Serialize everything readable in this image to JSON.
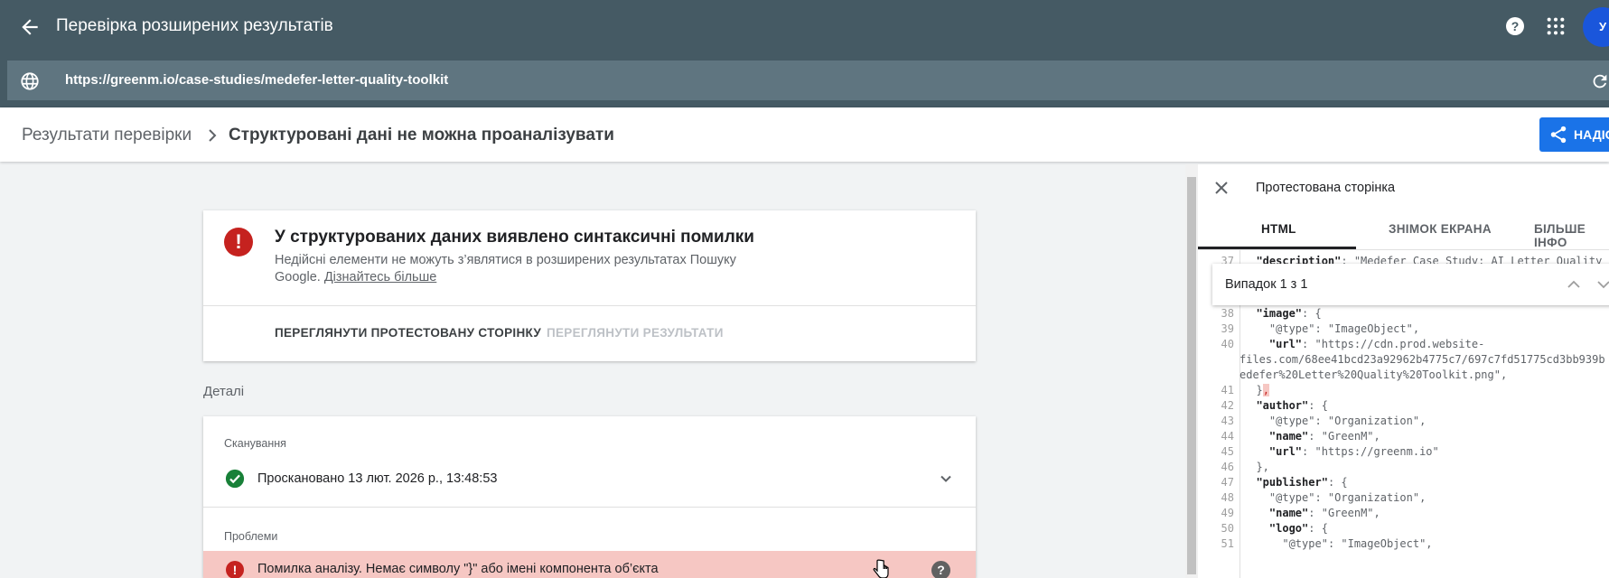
{
  "header": {
    "title": "Перевірка розширених результатів",
    "avatar_letter": "У"
  },
  "urlbar": {
    "url": "https://greenm.io/case-studies/medefer-letter-quality-toolkit"
  },
  "breadcrumb": {
    "item1": "Результати перевірки",
    "item2": "Структуровані дані не можна проаналізувати",
    "share_label": "НАДІС"
  },
  "summary_card": {
    "title": "У структурованих даних виявлено синтаксичні помилки",
    "desc": "Недійсні елементи не можуть з’являтися в розширених результатах Пошуку Google.",
    "link": "Дізнайтесь більше",
    "view_page_button": "ПЕРЕГЛЯНУТИ ПРОТЕСТОВАНУ СТОРІНКУ",
    "view_results_button": "ПЕРЕГЛЯНУТИ РЕЗУЛЬТАТИ"
  },
  "details": {
    "label": "Деталі",
    "scan_label": "Сканування",
    "scan_text": "Проскановано 13 лют. 2026 р., 13:48:53",
    "problems_label": "Проблеми",
    "problem_text": "Помилка аналізу. Немає символу \"}\" або імені компонента об’єкта"
  },
  "panel": {
    "title": "Протестована сторінка",
    "tabs": [
      "HTML",
      "ЗНІМОК ЕКРАНА",
      "БІЛЬШЕ ІНФО"
    ],
    "search_text": "Випадок 1 з 1",
    "code_lines": [
      {
        "n": "37",
        "t": "  \"description\": \"Medefer Case Study: AI Letter Quality"
      },
      {
        "n": "38",
        "t": "  \"image\": {"
      },
      {
        "n": "39",
        "t": "    \"@type\": \"ImageObject\","
      },
      {
        "n": "40",
        "t": "    \"url\": \"https://cdn.prod.website-"
      },
      {
        "n": "",
        "t": "files.com/68ee41bcd23a92962b4775c7/697c7fd51775cd3bb939b"
      },
      {
        "n": "",
        "t": "edefer%20Letter%20Quality%20Toolkit.png\","
      },
      {
        "n": "41",
        "t": "  },"
      },
      {
        "n": "42",
        "t": "  \"author\": {"
      },
      {
        "n": "43",
        "t": "    \"@type\": \"Organization\","
      },
      {
        "n": "44",
        "t": "    \"name\": \"GreenM\","
      },
      {
        "n": "45",
        "t": "    \"url\": \"https://greenm.io\""
      },
      {
        "n": "46",
        "t": "  },"
      },
      {
        "n": "47",
        "t": "  \"publisher\": {"
      },
      {
        "n": "48",
        "t": "    \"@type\": \"Organization\","
      },
      {
        "n": "49",
        "t": "    \"name\": \"GreenM\","
      },
      {
        "n": "50",
        "t": "    \"logo\": {"
      },
      {
        "n": "51",
        "t": "      \"@type\": \"ImageObject\","
      }
    ]
  },
  "colors": {
    "appbar": "#455a64",
    "accent": "#1a73e8",
    "error": "#c5221f",
    "error_bg": "#f6c7c3",
    "success": "#188038"
  }
}
